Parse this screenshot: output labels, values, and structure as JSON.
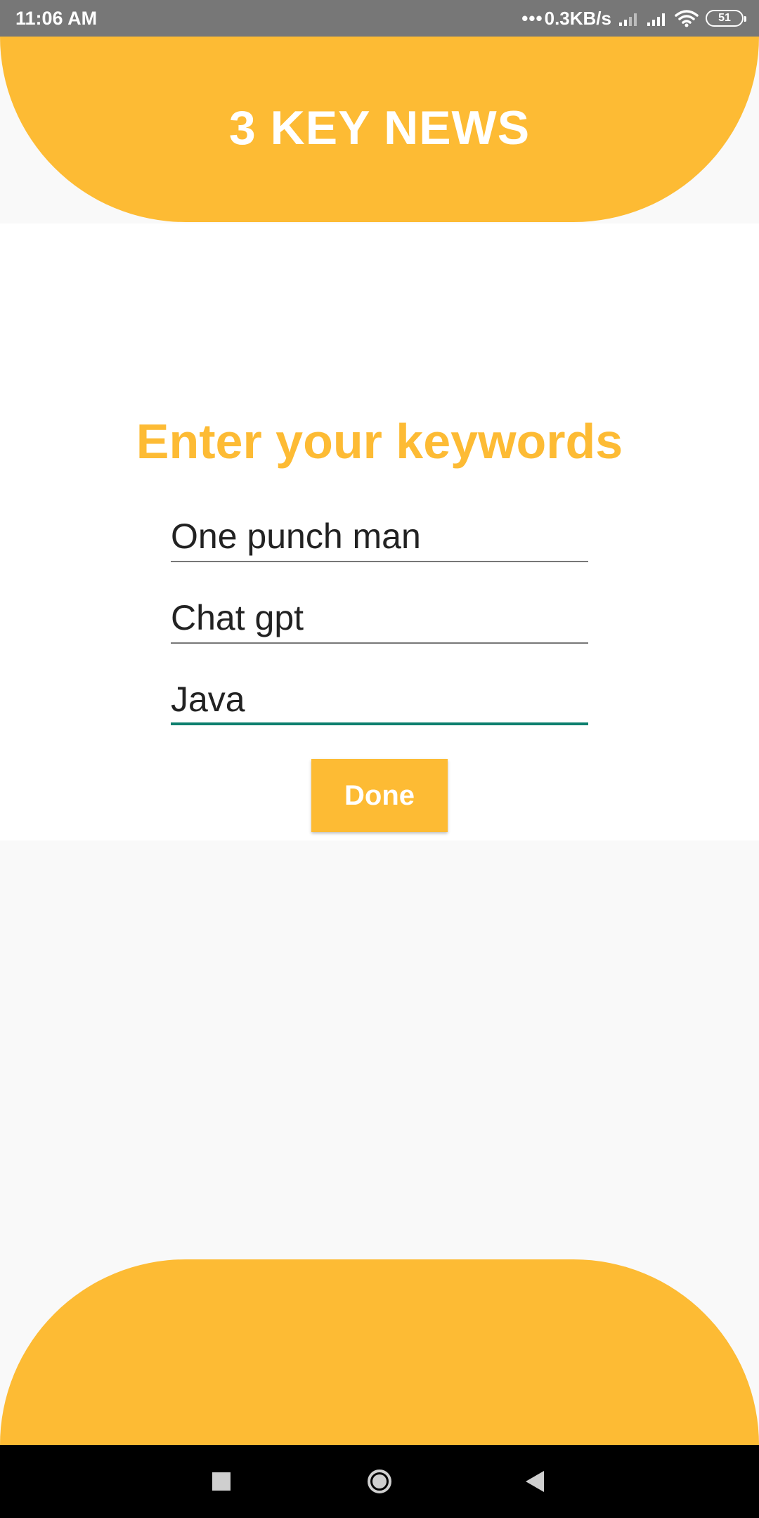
{
  "status_bar": {
    "time": "11:06 AM",
    "net_speed": "0.3KB/s",
    "battery_level": "51",
    "icons": [
      "more-dots-icon",
      "cell-signal-icon",
      "cell-signal-icon",
      "wifi-icon",
      "battery-icon"
    ]
  },
  "header": {
    "title": "3 KEY NEWS"
  },
  "form": {
    "title": "Enter your keywords",
    "keywords": [
      "One punch man",
      "Chat gpt",
      "Java"
    ],
    "focused_index": 2,
    "done_label": "Done"
  },
  "nav_bar": {
    "icons": [
      "recents-icon",
      "home-icon",
      "back-icon"
    ]
  },
  "colors": {
    "accent": "#fdbb34",
    "focus_underline": "#0d7f6e",
    "status_bar": "#777777",
    "background": "#f9f9f9"
  }
}
